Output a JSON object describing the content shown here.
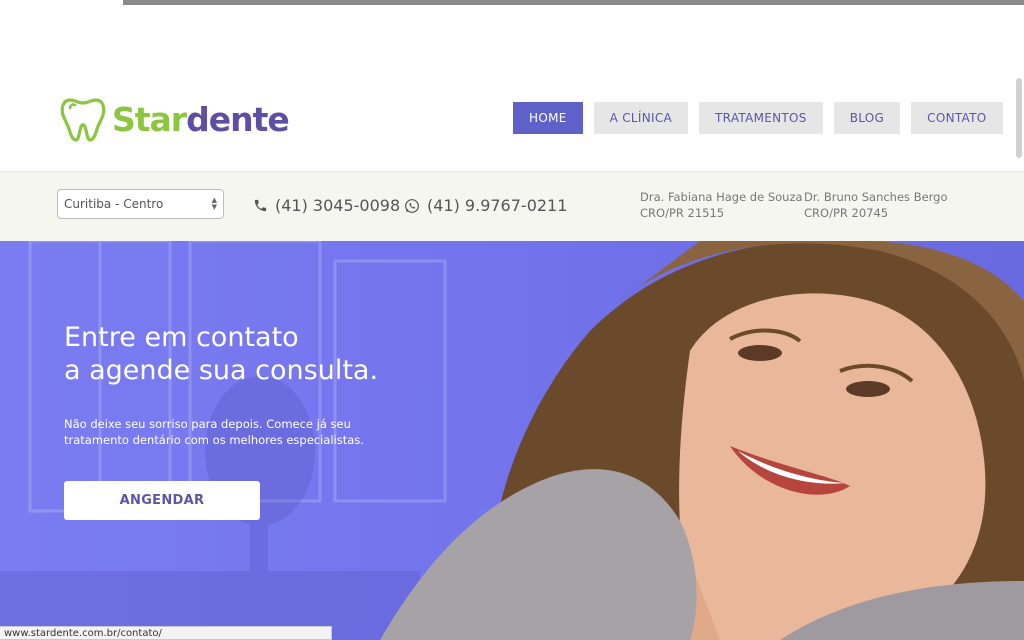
{
  "brand": {
    "name_part1": "Star",
    "name_part2": "dente",
    "colors": {
      "green": "#8cc63e",
      "purple": "#5d4fa3",
      "nav_active": "#6061c8",
      "hero": "#7475ed"
    }
  },
  "nav": {
    "items": [
      {
        "label": "HOME",
        "active": true
      },
      {
        "label": "A CLÍNICA",
        "active": false
      },
      {
        "label": "TRATAMENTOS",
        "active": false
      },
      {
        "label": "BLOG",
        "active": false
      },
      {
        "label": "CONTATO",
        "active": false
      }
    ]
  },
  "infobar": {
    "location_select": {
      "value": "Curitiba - Centro"
    },
    "phone": {
      "icon": "phone-icon",
      "number": "(41) 3045-0098"
    },
    "whatsapp": {
      "icon": "whatsapp-icon",
      "number": "(41) 9.9767-0211"
    },
    "doctors": [
      {
        "name": "Dra. Fabiana Hage de Souza",
        "cro": "CRO/PR 21515"
      },
      {
        "name": "Dr. Bruno Sanches Bergo",
        "cro": "CRO/PR 20745"
      }
    ]
  },
  "hero": {
    "title_line1": "Entre em contato",
    "title_line2": "a agende sua consulta.",
    "subtitle": "Não deixe seu sorriso para depois. Comece já seu tratamento dentário com os melhores especialistas.",
    "button_label": "ANGENDAR"
  },
  "status": {
    "url": "www.stardente.com.br/contato/"
  }
}
